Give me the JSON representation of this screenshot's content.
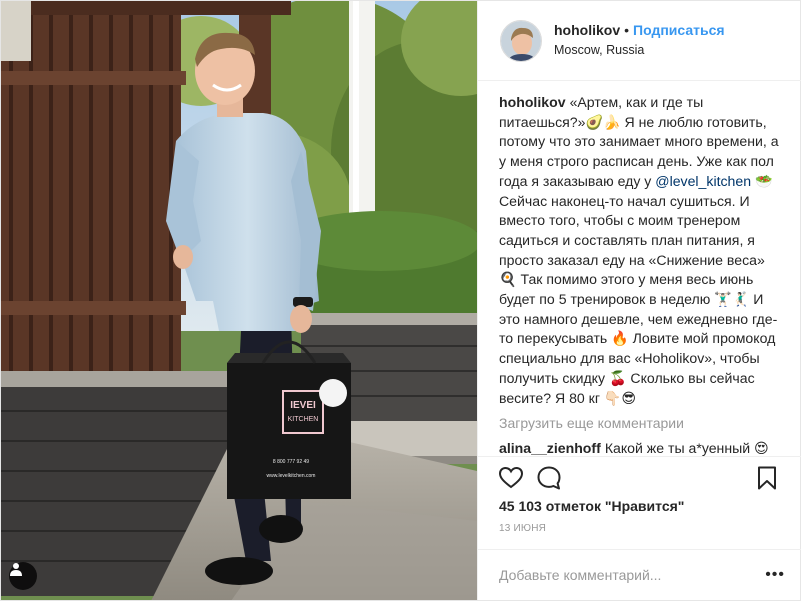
{
  "post": {
    "author": {
      "username": "hoholikov",
      "separator": "•",
      "follow_label": "Подписаться",
      "location": "Moscow, Russia"
    },
    "caption": {
      "username": "hoholikov",
      "part1": "«Артем, как и где ты питаешься?»🥑🍌 Я не люблю готовить, потому что это занимает много времени, а у меня строго расписан день. Уже как пол года я заказываю еду у ",
      "mention": "@level_kitchen",
      "part2": " 🥗 Сейчас наконец-то начал сушиться. И вместо того, чтобы с моим тренером садиться и составлять план питания, я просто заказал еду на «Снижение веса» 🍳 Так помимо этого у меня весь июнь будет по 5 тренировок в неделю 🏋🏻‍♂️🤾🏻‍♂️ И это намного дешевле, чем ежедневно где-то перекусывать 🔥 Ловите мой промокод специально для вас «Hoholikov», чтобы получить скидку 🍒 Сколько вы сейчас весите? Я 80 кг 👇🏻😎"
    },
    "load_more_label": "Загрузить еще комментарии",
    "comments": [
      {
        "username": "alina__zienhoff",
        "text": "Какой же ты а*уенный 😍"
      }
    ],
    "likes_label": "45 103 отметок \"Нравится\"",
    "date_label": "13 ИЮНЯ",
    "add_comment_placeholder": "Добавьте комментарий...",
    "more_options_label": "•••"
  },
  "icons": {
    "like": "heart-outline-icon",
    "comment": "speech-bubble-icon",
    "save": "bookmark-icon",
    "tagged_user": "person-icon"
  },
  "colors": {
    "follow_blue": "#3897f0",
    "mention": "#003569",
    "muted_text": "#999999"
  }
}
